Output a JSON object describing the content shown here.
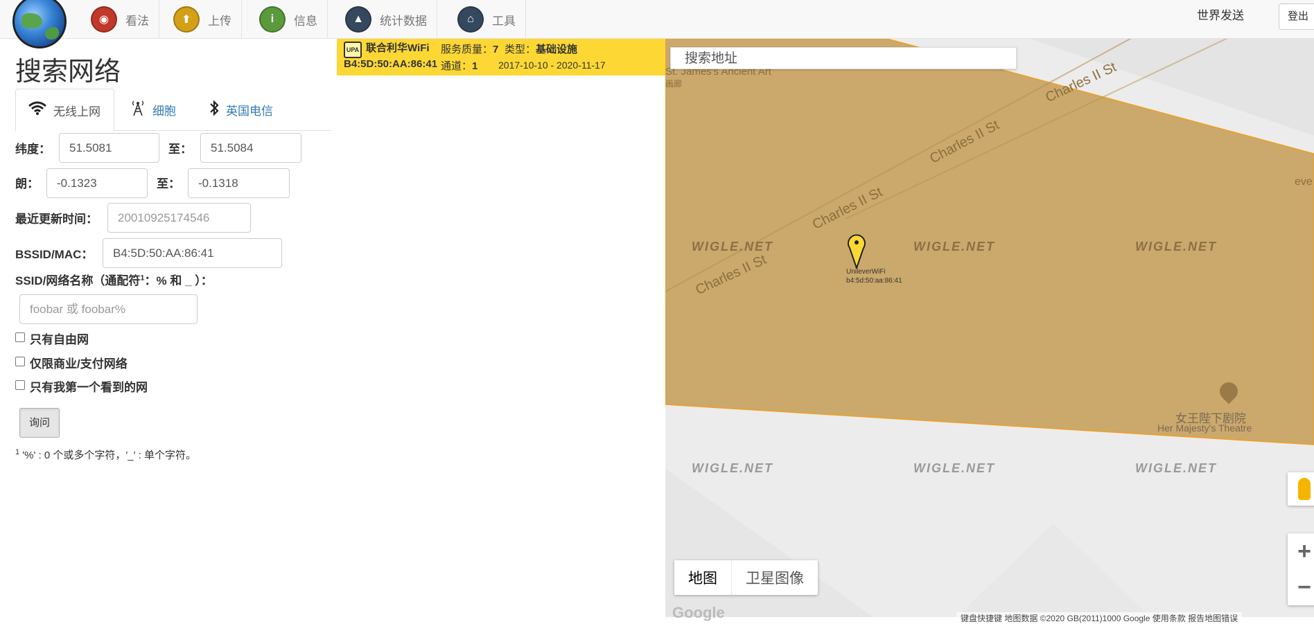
{
  "nav": {
    "items": [
      {
        "label": "看法",
        "icon": "eye-icon",
        "color": "#c0392b"
      },
      {
        "label": "上传",
        "icon": "upload-icon",
        "color": "#d4a017"
      },
      {
        "label": "信息",
        "icon": "info-icon",
        "color": "#5a9a3c"
      },
      {
        "label": "统计数据",
        "icon": "stats-icon",
        "color": "#34495e"
      },
      {
        "label": "工具",
        "icon": "tools-icon",
        "color": "#34495e"
      }
    ],
    "world_send": "世界发送",
    "logout": "登出"
  },
  "form": {
    "title": "搜索网络",
    "tabs": [
      {
        "label": "无线上网",
        "icon": "wifi-icon",
        "active": true
      },
      {
        "label": "细胞",
        "icon": "cell-tower-icon",
        "active": false
      },
      {
        "label": "英国电信",
        "icon": "bluetooth-icon",
        "active": false
      }
    ],
    "lat_label": "纬度：",
    "lat_from": "51.5081",
    "to_label": "至：",
    "lat_to": "51.5084",
    "lon_label": "朗：",
    "lon_from": "-0.1323",
    "lon_to": "-0.1318",
    "last_update_label": "最近更新时间：",
    "last_update_placeholder": "20010925174546",
    "bssid_label": "BSSID/MAC：",
    "bssid_value": "B4:5D:50:AA:86:41",
    "ssid_label_pre": "SSID/网络名称（通配符",
    "ssid_label_sup": "1",
    "ssid_label_post": "：% 和 _ ）：",
    "ssid_placeholder": "foobar 或 foobar%",
    "checkboxes": [
      "只有自由网",
      "仅限商业/支付网络",
      "只有我第一个看到的网"
    ],
    "query_button": "询问",
    "footnote_sup": "1",
    "footnote_text": " '%' : 0 个或多个字符，'_' : 单个字符。"
  },
  "result": {
    "icon_text": "UPA",
    "ssid": "联合利华WiFi",
    "qos_label": "服务质量：",
    "qos_value": "7",
    "type_label": "类型：",
    "type_value": "基础设施",
    "bssid": "B4:5D:50:AA:86:41",
    "channel_label": "通道：",
    "channel_value": "1",
    "date_range": "2017-10-10 - 2020-11-17"
  },
  "map": {
    "search_placeholder": "搜索地址",
    "street_name": "Charles II St",
    "poi_1": "St. James's Ancient Art",
    "poi_1_sub": "画廊",
    "poi_2_cn": "女王陛下剧院",
    "poi_2_en": "Her Majesty's Theatre",
    "poi_3": "eve",
    "watermark": "WIGLE.NET",
    "pin_label": "UnileverWiFi",
    "pin_sub": "b4:5d:50:aa:86:41",
    "map_type_map": "地图",
    "map_type_satellite": "卫星图像",
    "zoom_in": "+",
    "zoom_out": "−",
    "google": "Google",
    "footer": "键盘快捷键   地图数据 ©2020 GB(2011)1000 Google   使用条款   报告地图错误",
    "highlight_color": "#c9a465",
    "pin_color": "#fdd835"
  }
}
